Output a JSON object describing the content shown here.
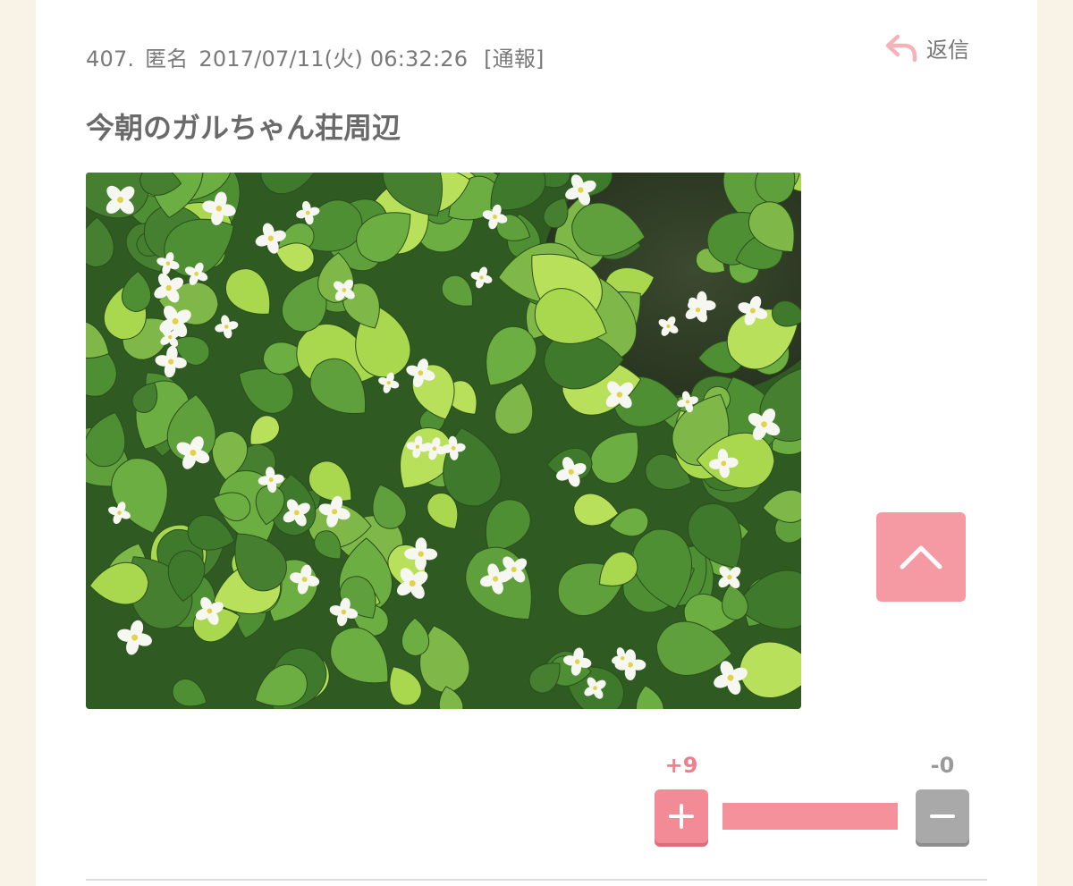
{
  "comment": {
    "number": "407.",
    "author": "匿名",
    "datetime": "2017/07/11(火) 06:32:26",
    "report_label": "[通報]",
    "reply_label": "返信",
    "body": "今朝のガルちゃん荘周辺",
    "image_icon": "photo-of-white-dokudami-flowers"
  },
  "votes": {
    "plus_label": "+9",
    "minus_label": "-0",
    "plus_value": 9,
    "minus_value": 0,
    "plus_fraction": 1.0
  },
  "icons": {
    "reply": "reply-arrow-icon",
    "scroll_top": "chevron-up-icon",
    "plus": "plus-icon",
    "minus": "minus-icon"
  },
  "colors": {
    "accent_pink": "#f28b96",
    "page_background": "#f8f2e7",
    "minus_gray": "#a9a9a9"
  }
}
